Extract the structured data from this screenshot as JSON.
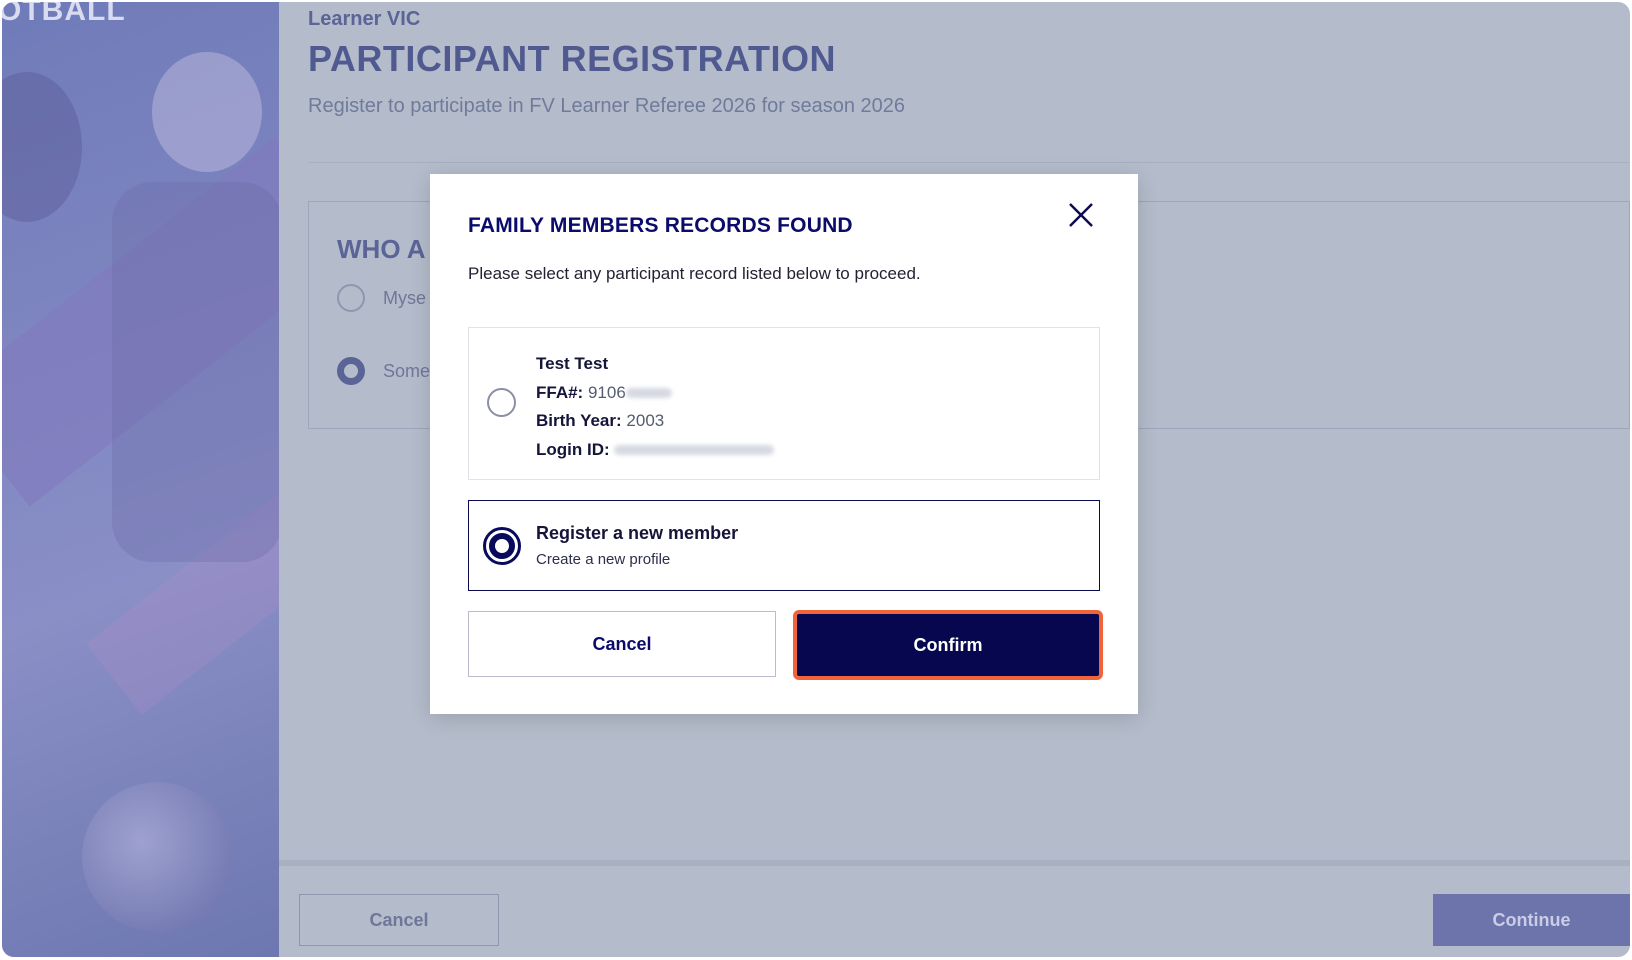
{
  "hero": {
    "brand_text": "OTBALL"
  },
  "page": {
    "subtitle": "Learner VIC",
    "title": "PARTICIPANT REGISTRATION",
    "description": "Register to participate in FV Learner Referee 2026 for season 2026"
  },
  "who_card": {
    "title": "WHO A",
    "options": [
      {
        "label": "Myse",
        "selected": false
      },
      {
        "label": "Some",
        "selected": true
      }
    ]
  },
  "footer": {
    "cancel_label": "Cancel",
    "continue_label": "Continue"
  },
  "modal": {
    "title": "FAMILY MEMBERS RECORDS FOUND",
    "description": "Please select any participant record listed below to proceed.",
    "close_icon": "close-icon",
    "record": {
      "name": "Test Test",
      "ffa_label": "FFA#:",
      "ffa_value": "9106",
      "birth_label": "Birth Year:",
      "birth_value": "2003",
      "login_label": "Login ID:",
      "selected": false
    },
    "new_member": {
      "title": "Register a new member",
      "subtitle": "Create a new profile",
      "selected": true
    },
    "cancel_label": "Cancel",
    "confirm_label": "Confirm"
  },
  "colors": {
    "overlay": "#b4bccb",
    "navy": "#07074f",
    "confirm_border": "#f0643c",
    "hero_purple": "#7f86c0"
  }
}
